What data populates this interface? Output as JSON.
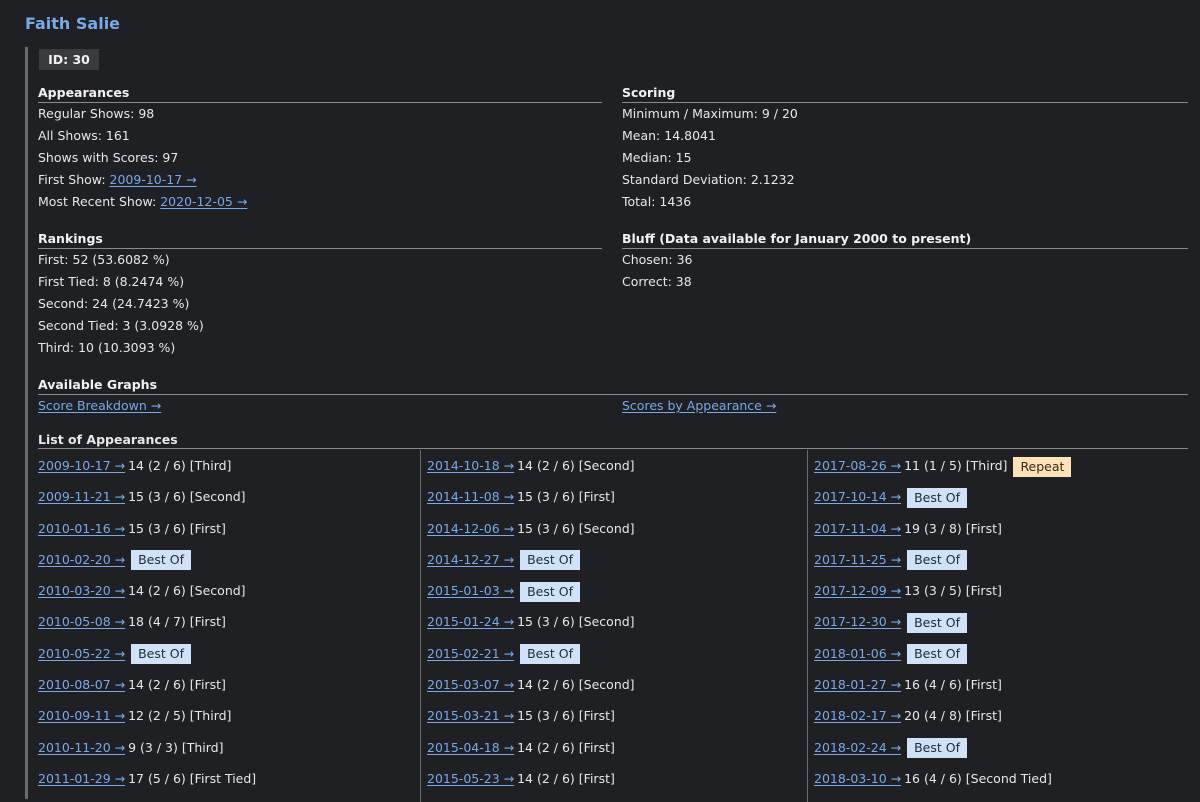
{
  "title": "Faith Salie",
  "id_label": "ID: 30",
  "appearances": {
    "title": "Appearances",
    "regular": "Regular Shows: 98",
    "all": "All Shows: 161",
    "with_scores": "Shows with Scores: 97",
    "first_label": "First Show: ",
    "first_link": "2009-10-17 →",
    "recent_label": "Most Recent Show: ",
    "recent_link": "2020-12-05 →"
  },
  "scoring": {
    "title": "Scoring",
    "minmax": "Minimum / Maximum: 9 / 20",
    "mean": "Mean: 14.8041",
    "median": "Median: 15",
    "stddev": "Standard Deviation: 2.1232",
    "total": "Total: 1436"
  },
  "rankings": {
    "title": "Rankings",
    "first": "First: 52 (53.6082 %)",
    "first_tied": "First Tied: 8 (8.2474 %)",
    "second": "Second: 24 (24.7423 %)",
    "second_tied": "Second Tied: 3 (3.0928 %)",
    "third": "Third: 10 (10.3093 %)"
  },
  "bluff": {
    "title": "Bluff (Data available for January 2000 to present)",
    "chosen": "Chosen: 36",
    "correct": "Correct: 38"
  },
  "graphs": {
    "title": "Available Graphs",
    "score_breakdown": "Score Breakdown →",
    "scores_by_appearance": "Scores by Appearance →"
  },
  "list": {
    "title": "List of Appearances",
    "col1": [
      {
        "date": "2009-10-17 →",
        "score": "14 (2 / 6)",
        "place": "[Third]",
        "badge": ""
      },
      {
        "date": "2009-11-21 →",
        "score": "15 (3 / 6)",
        "place": "[Second]",
        "badge": ""
      },
      {
        "date": "2010-01-16 →",
        "score": "15 (3 / 6)",
        "place": "[First]",
        "badge": ""
      },
      {
        "date": "2010-02-20 →",
        "score": "",
        "place": "",
        "badge": "Best Of"
      },
      {
        "date": "2010-03-20 →",
        "score": "14 (2 / 6)",
        "place": "[Second]",
        "badge": ""
      },
      {
        "date": "2010-05-08 →",
        "score": "18 (4 / 7)",
        "place": "[First]",
        "badge": ""
      },
      {
        "date": "2010-05-22 →",
        "score": "",
        "place": "",
        "badge": "Best Of"
      },
      {
        "date": "2010-08-07 →",
        "score": "14 (2 / 6)",
        "place": "[First]",
        "badge": ""
      },
      {
        "date": "2010-09-11 →",
        "score": "12 (2 / 5)",
        "place": "[Third]",
        "badge": ""
      },
      {
        "date": "2010-11-20 →",
        "score": "9 (3 / 3)",
        "place": "[Third]",
        "badge": ""
      },
      {
        "date": "2011-01-29 →",
        "score": "17 (5 / 6)",
        "place": "[First Tied]",
        "badge": ""
      }
    ],
    "col2": [
      {
        "date": "2014-10-18 →",
        "score": "14 (2 / 6)",
        "place": "[Second]",
        "badge": ""
      },
      {
        "date": "2014-11-08 →",
        "score": "15 (3 / 6)",
        "place": "[First]",
        "badge": ""
      },
      {
        "date": "2014-12-06 →",
        "score": "15 (3 / 6)",
        "place": "[Second]",
        "badge": ""
      },
      {
        "date": "2014-12-27 →",
        "score": "",
        "place": "",
        "badge": "Best Of"
      },
      {
        "date": "2015-01-03 →",
        "score": "",
        "place": "",
        "badge": "Best Of"
      },
      {
        "date": "2015-01-24 →",
        "score": "15 (3 / 6)",
        "place": "[Second]",
        "badge": ""
      },
      {
        "date": "2015-02-21 →",
        "score": "",
        "place": "",
        "badge": "Best Of"
      },
      {
        "date": "2015-03-07 →",
        "score": "14 (2 / 6)",
        "place": "[Second]",
        "badge": ""
      },
      {
        "date": "2015-03-21 →",
        "score": "15 (3 / 6)",
        "place": "[First]",
        "badge": ""
      },
      {
        "date": "2015-04-18 →",
        "score": "14 (2 / 6)",
        "place": "[First]",
        "badge": ""
      },
      {
        "date": "2015-05-23 →",
        "score": "14 (2 / 6)",
        "place": "[First]",
        "badge": ""
      }
    ],
    "col3": [
      {
        "date": "2017-08-26 →",
        "score": "11 (1 / 5)",
        "place": "[Third]",
        "badge": "Repeat"
      },
      {
        "date": "2017-10-14 →",
        "score": "",
        "place": "",
        "badge": "Best Of"
      },
      {
        "date": "2017-11-04 →",
        "score": "19 (3 / 8)",
        "place": "[First]",
        "badge": ""
      },
      {
        "date": "2017-11-25 →",
        "score": "",
        "place": "",
        "badge": "Best Of"
      },
      {
        "date": "2017-12-09 →",
        "score": "13 (3 / 5)",
        "place": "[First]",
        "badge": ""
      },
      {
        "date": "2017-12-30 →",
        "score": "",
        "place": "",
        "badge": "Best Of"
      },
      {
        "date": "2018-01-06 →",
        "score": "",
        "place": "",
        "badge": "Best Of"
      },
      {
        "date": "2018-01-27 →",
        "score": "16 (4 / 6)",
        "place": "[First]",
        "badge": ""
      },
      {
        "date": "2018-02-17 →",
        "score": "20 (4 / 8)",
        "place": "[First]",
        "badge": ""
      },
      {
        "date": "2018-02-24 →",
        "score": "",
        "place": "",
        "badge": "Best Of"
      },
      {
        "date": "2018-03-10 →",
        "score": "16 (4 / 6)",
        "place": "[Second Tied]",
        "badge": ""
      }
    ]
  }
}
